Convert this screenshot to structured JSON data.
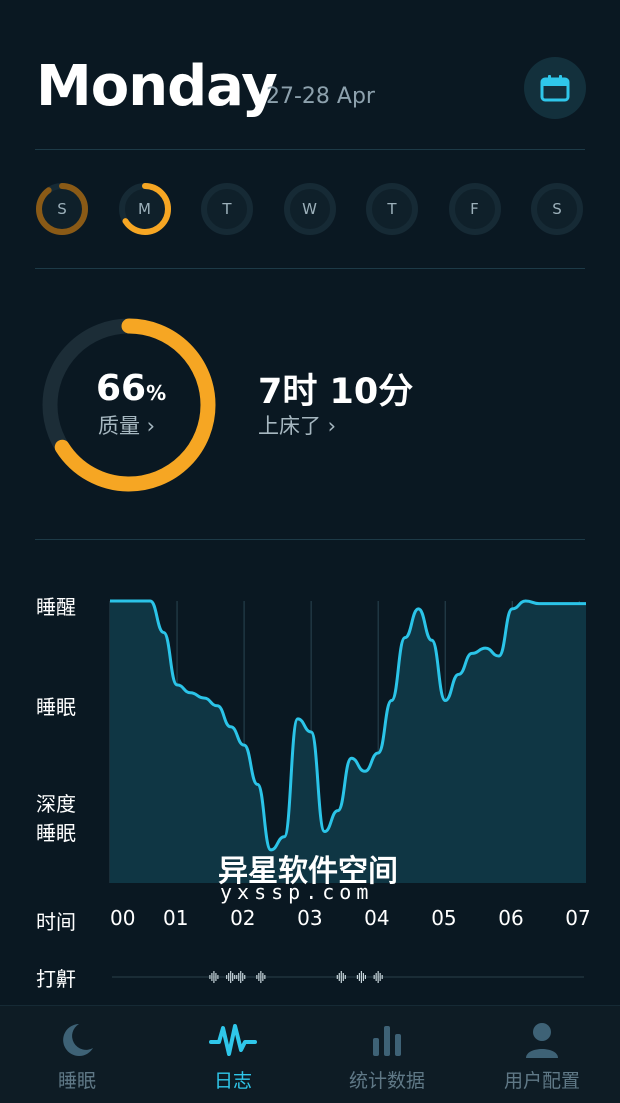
{
  "header": {
    "title": "Monday",
    "date_range": "27-28 Apr",
    "calendar_icon": "calendar-icon"
  },
  "week_days": [
    {
      "label": "S",
      "quality": 0.9,
      "color": "#8a5a16"
    },
    {
      "label": "M",
      "quality": 0.66,
      "color": "#f6a623"
    },
    {
      "label": "T",
      "quality": 0,
      "color": "#162a35"
    },
    {
      "label": "W",
      "quality": 0,
      "color": "#162a35"
    },
    {
      "label": "T",
      "quality": 0,
      "color": "#162a35"
    },
    {
      "label": "F",
      "quality": 0,
      "color": "#162a35"
    },
    {
      "label": "S",
      "quality": 0,
      "color": "#162a35"
    }
  ],
  "summary": {
    "quality_value": "66",
    "quality_unit": "%",
    "quality_fraction": 0.66,
    "quality_label": "质量 ›",
    "duration": "7时 10分",
    "bedtime_label": "上床了 ›",
    "accent": "#f6a623"
  },
  "chart_labels": {
    "awake": "睡醒",
    "sleep": "睡眠",
    "deep_1": "深度",
    "deep_2": "睡眠",
    "time": "时间",
    "snore": "打鼾"
  },
  "chart_data": {
    "type": "area",
    "x_ticks": [
      "00",
      "01",
      "02",
      "03",
      "04",
      "05",
      "06",
      "07"
    ],
    "y_levels": [
      "深度睡眠",
      "睡眠",
      "睡醒"
    ],
    "x": [
      0,
      0.3,
      0.6,
      0.8,
      1.0,
      1.2,
      1.4,
      1.6,
      1.8,
      2.0,
      2.2,
      2.4,
      2.6,
      2.8,
      3.0,
      3.2,
      3.4,
      3.6,
      3.8,
      4.0,
      4.2,
      4.4,
      4.6,
      4.8,
      5.0,
      5.2,
      5.4,
      5.6,
      5.8,
      6.0,
      6.2,
      6.4,
      6.6,
      6.8,
      7.0,
      7.1
    ],
    "y": [
      1.0,
      1.0,
      1.0,
      0.88,
      0.68,
      0.65,
      0.63,
      0.6,
      0.52,
      0.45,
      0.3,
      0.05,
      0.1,
      0.55,
      0.5,
      0.12,
      0.2,
      0.4,
      0.35,
      0.42,
      0.62,
      0.86,
      0.97,
      0.85,
      0.62,
      0.72,
      0.8,
      0.82,
      0.79,
      0.97,
      1.0,
      0.99,
      0.99,
      0.99,
      0.99,
      0.99
    ],
    "color": "#2bc4e8",
    "snore_events_hours": [
      1.55,
      1.8,
      1.95,
      2.25,
      3.45,
      3.75,
      4.0
    ]
  },
  "watermark": {
    "line1": "异星软件空间",
    "line2": "yxssp.com"
  },
  "tabs": [
    {
      "label": "睡眠",
      "icon": "moon-icon",
      "active": false
    },
    {
      "label": "日志",
      "icon": "waveform-icon",
      "active": true
    },
    {
      "label": "统计数据",
      "icon": "bar-chart-icon",
      "active": false
    },
    {
      "label": "用户配置",
      "icon": "user-icon",
      "active": false
    }
  ]
}
